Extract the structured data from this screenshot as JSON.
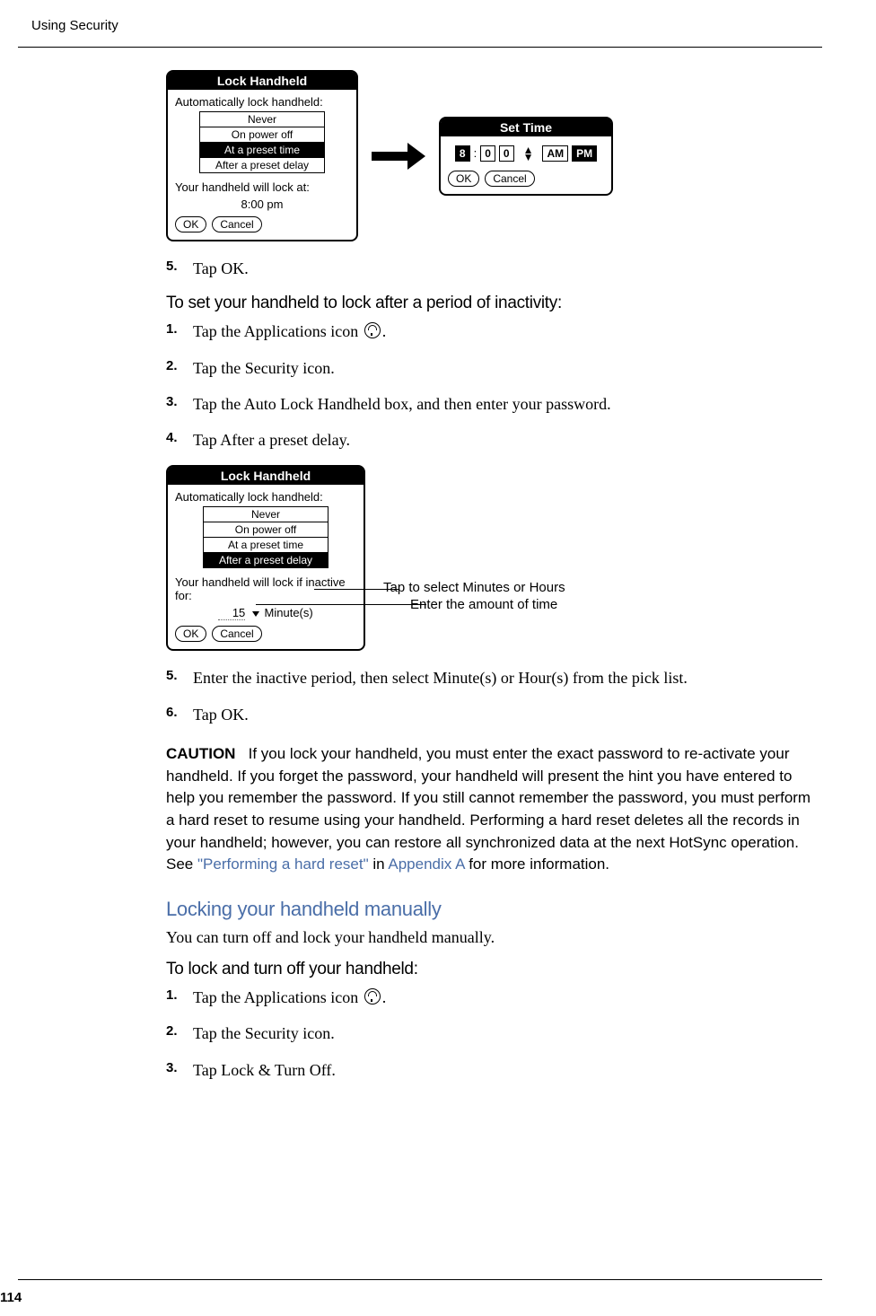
{
  "header": "Using Security",
  "page_number": "114",
  "dialog1": {
    "title": "Lock Handheld",
    "label1": "Automatically lock handheld:",
    "options": [
      "Never",
      "On power off",
      "At a preset time",
      "After a preset delay"
    ],
    "selected_index": 2,
    "label2": "Your handheld will lock at:",
    "time_value": "8:00 pm",
    "ok": "OK",
    "cancel": "Cancel"
  },
  "settime": {
    "title": "Set Time",
    "hour": "8",
    "min1": "0",
    "min2": "0",
    "am": "AM",
    "pm": "PM",
    "ok": "OK",
    "cancel": "Cancel"
  },
  "step5a": "Tap OK.",
  "subheading1": "To set your handheld to lock after a period of inactivity:",
  "steps_a": {
    "s1": "Tap the Applications icon ",
    "s1_suffix": ".",
    "s2": "Tap the Security icon.",
    "s3": "Tap the Auto Lock Handheld box, and then enter your password.",
    "s4": "Tap After a preset delay."
  },
  "dialog2": {
    "title": "Lock Handheld",
    "label1": "Automatically lock handheld:",
    "options": [
      "Never",
      "On power off",
      "At a preset time",
      "After a preset delay"
    ],
    "selected_index": 3,
    "label2": "Your handheld will lock if inactive for:",
    "delay_value": "15",
    "unit": "Minute(s)",
    "ok": "OK",
    "cancel": "Cancel"
  },
  "callouts": {
    "c1": "Tap to select Minutes or Hours",
    "c2": "Enter the amount of time"
  },
  "step5b": "Enter the inactive period, then select Minute(s) or Hour(s) from the pick list.",
  "step6": "Tap OK.",
  "caution": {
    "label": "CAUTION",
    "text_before": "If you lock your handheld, you must enter the exact password to re-activate your handheld. If you forget the password, your handheld will present the hint you have entered to help you remember the password. If you still cannot remember the password, you must perform a hard reset to resume using your handheld. Performing a hard reset deletes all the records in your handheld; however, you can restore all synchronized data at the next HotSync operation. See ",
    "link1": "\"Performing a hard reset\"",
    "mid": " in ",
    "link2": "Appendix A",
    "after": " for more information."
  },
  "h2": "Locking your handheld manually",
  "body1": "You can turn off and lock your handheld manually.",
  "subheading2": "To lock and turn off your handheld:",
  "steps_b": {
    "s1": "Tap the Applications icon ",
    "s1_suffix": ".",
    "s2": "Tap the Security icon.",
    "s3": "Tap Lock & Turn Off."
  }
}
